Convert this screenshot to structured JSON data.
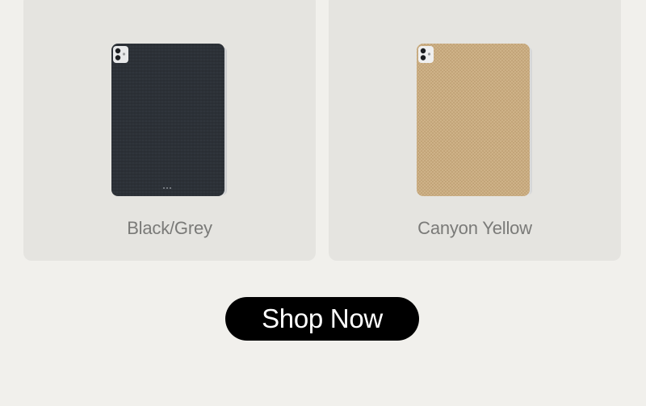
{
  "products": [
    {
      "label": "Black/Grey",
      "case_color": "#2b3036",
      "frame_color": "#d7d8d9"
    },
    {
      "label": "Canyon Yellow",
      "case_color": "#c9ab80",
      "frame_color": "#e3e3e1"
    }
  ],
  "cta": {
    "label": "Shop Now",
    "background": "#000000",
    "text_color": "#ffffff"
  },
  "colors": {
    "page_background": "#f1f0ec",
    "card_background": "#e5e4e0",
    "label_color": "#7a7a78"
  }
}
